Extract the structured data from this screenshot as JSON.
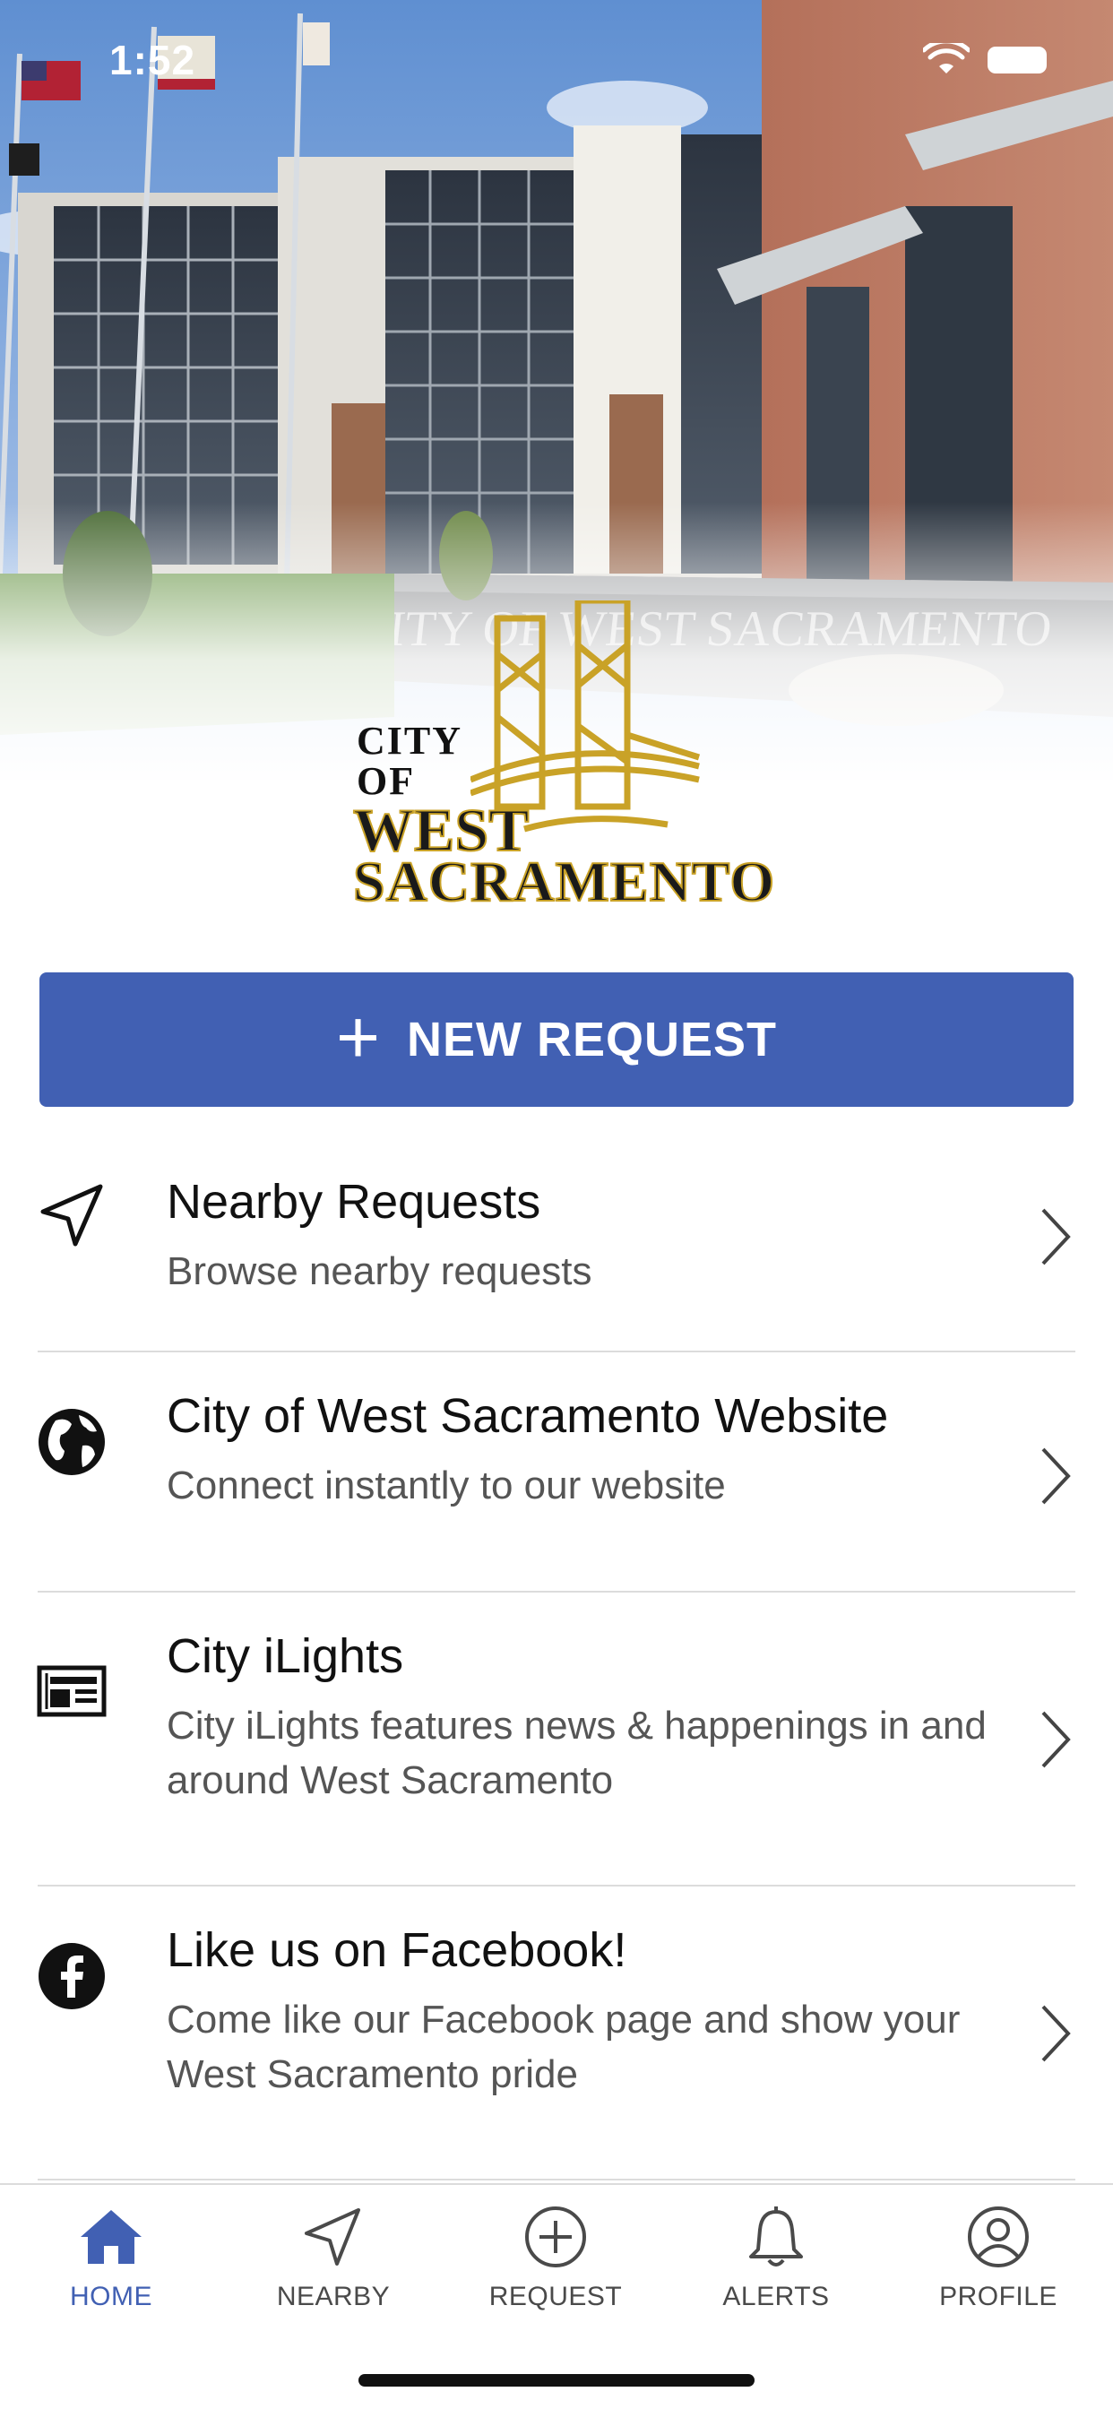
{
  "status_bar": {
    "time": "1:52"
  },
  "logo": {
    "line1": "CITY",
    "line2": "OF",
    "line3": "WEST",
    "line4": "SACRAMENTO",
    "monument_text": "CITY OF WEST SACRAMENTO"
  },
  "new_request": {
    "icon": "plus-icon",
    "label": "NEW REQUEST"
  },
  "menu": [
    {
      "icon": "navigation-arrow-icon",
      "title": "Nearby Requests",
      "subtitle": "Browse nearby requests"
    },
    {
      "icon": "globe-icon",
      "title": "City of West Sacramento Website",
      "subtitle": "Connect instantly to our website"
    },
    {
      "icon": "newspaper-icon",
      "title": "City iLights",
      "subtitle": "City iLights features news & happenings in and around West Sacramento"
    },
    {
      "icon": "facebook-icon",
      "title": "Like us on Facebook!",
      "subtitle": "Come like our Facebook page and show your West Sacramento pride"
    }
  ],
  "tabs": [
    {
      "icon": "home-icon",
      "label": "HOME",
      "active": true
    },
    {
      "icon": "navigation-arrow-icon",
      "label": "NEARBY",
      "active": false
    },
    {
      "icon": "plus-circle-icon",
      "label": "REQUEST",
      "active": false
    },
    {
      "icon": "bell-icon",
      "label": "ALERTS",
      "active": false
    },
    {
      "icon": "user-circle-icon",
      "label": "PROFILE",
      "active": false
    }
  ],
  "colors": {
    "accent": "#4160b3",
    "logo_gold": "#c9a227"
  }
}
